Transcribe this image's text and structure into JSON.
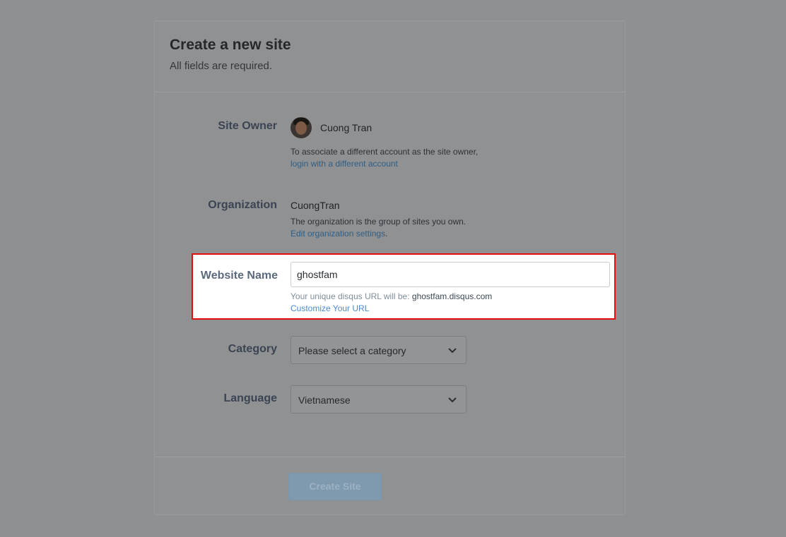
{
  "form": {
    "title": "Create a new site",
    "subtitle": "All fields are required."
  },
  "site_owner": {
    "label": "Site Owner",
    "name": "Cuong Tran",
    "help_text": "To associate a different account as the site owner,",
    "link_text": "login with a different account"
  },
  "organization": {
    "label": "Organization",
    "value": "CuongTran",
    "help_text": "The organization is the group of sites you own.",
    "link_text": "Edit organization settings",
    "link_suffix": "."
  },
  "website_name": {
    "label": "Website Name",
    "value": "ghostfam",
    "help_prefix": "Your unique disqus URL will be: ",
    "url": "ghostfam.disqus.com",
    "link_text": "Customize Your URL"
  },
  "category": {
    "label": "Category",
    "selected": "Please select a category"
  },
  "language": {
    "label": "Language",
    "selected": "Vietnamese"
  },
  "footer": {
    "create_label": "Create Site"
  },
  "colors": {
    "overlay": "#8f9091",
    "highlight_border": "#e40c0c",
    "link": "#4a8ad1"
  },
  "icons": {
    "select_caret": "chevron-down-icon"
  }
}
